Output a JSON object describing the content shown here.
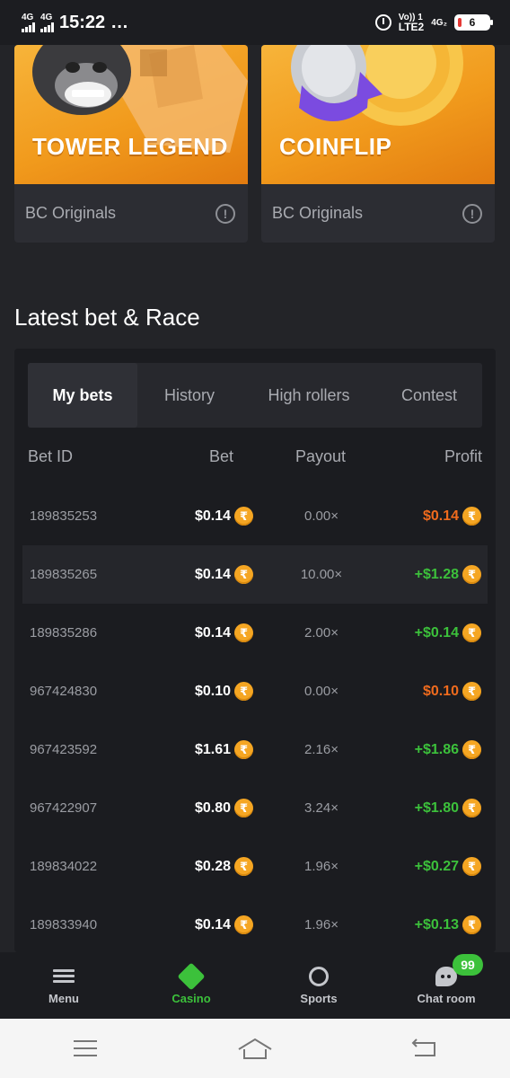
{
  "status_bar": {
    "time": "15:22",
    "dots": "…",
    "signal_1": "4G",
    "signal_2": "4G",
    "volte": "Vo)) 1",
    "lte": "LTE2",
    "net_right": "4G₂",
    "battery": "6"
  },
  "games": [
    {
      "title": "TOWER LEGEND",
      "provider": "BC Originals",
      "info": "!"
    },
    {
      "title": "COINFLIP",
      "provider": "BC Originals",
      "info": "!"
    }
  ],
  "section": {
    "title": "Latest bet & Race"
  },
  "tabs": [
    {
      "label": "My bets",
      "active": true
    },
    {
      "label": "History",
      "active": false
    },
    {
      "label": "High rollers",
      "active": false
    },
    {
      "label": "Contest",
      "active": false
    }
  ],
  "table": {
    "headers": {
      "bet_id": "Bet ID",
      "bet": "Bet",
      "payout": "Payout",
      "profit": "Profit"
    },
    "currency_symbol": "₹",
    "rows": [
      {
        "id": "189835253",
        "bet": "$0.14",
        "payout": "0.00×",
        "profit": "$0.14",
        "profit_sign": "neg"
      },
      {
        "id": "189835265",
        "bet": "$0.14",
        "payout": "10.00×",
        "profit": "+$1.28",
        "profit_sign": "pos"
      },
      {
        "id": "189835286",
        "bet": "$0.14",
        "payout": "2.00×",
        "profit": "+$0.14",
        "profit_sign": "pos"
      },
      {
        "id": "967424830",
        "bet": "$0.10",
        "payout": "0.00×",
        "profit": "$0.10",
        "profit_sign": "neg"
      },
      {
        "id": "967423592",
        "bet": "$1.61",
        "payout": "2.16×",
        "profit": "+$1.86",
        "profit_sign": "pos"
      },
      {
        "id": "967422907",
        "bet": "$0.80",
        "payout": "3.24×",
        "profit": "+$1.80",
        "profit_sign": "pos"
      },
      {
        "id": "189834022",
        "bet": "$0.28",
        "payout": "1.96×",
        "profit": "+$0.27",
        "profit_sign": "pos"
      },
      {
        "id": "189833940",
        "bet": "$0.14",
        "payout": "1.96×",
        "profit": "+$0.13",
        "profit_sign": "pos"
      }
    ]
  },
  "bottom_nav": [
    {
      "label": "Menu",
      "icon": "menu-icon",
      "active": false
    },
    {
      "label": "Casino",
      "icon": "casino-icon",
      "active": true
    },
    {
      "label": "Sports",
      "icon": "sports-icon",
      "active": false
    },
    {
      "label": "Chat room",
      "icon": "chat-icon",
      "active": false,
      "badge": "99"
    }
  ],
  "colors": {
    "accent_green": "#3cc13b",
    "loss_orange": "#f06b1d",
    "coin": "#f5a623",
    "background": "#232428"
  }
}
